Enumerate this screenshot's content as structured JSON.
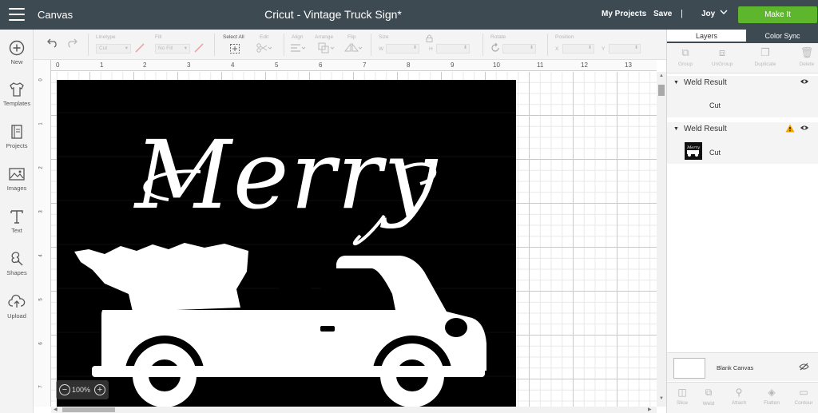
{
  "header": {
    "app_name": "Canvas",
    "doc_title": "Cricut - Vintage Truck Sign*",
    "my_projects": "My Projects",
    "save": "Save",
    "separator": "|",
    "user": "Joy",
    "make_it": "Make It",
    "make_it_color": "#5eb62c",
    "bar_color": "#3e4a52"
  },
  "left_tools": [
    {
      "label": "New",
      "icon": "plus-circle-icon"
    },
    {
      "label": "Templates",
      "icon": "tshirt-icon"
    },
    {
      "label": "Projects",
      "icon": "book-icon"
    },
    {
      "label": "Images",
      "icon": "image-icon"
    },
    {
      "label": "Text",
      "icon": "text-icon"
    },
    {
      "label": "Shapes",
      "icon": "shapes-icon"
    },
    {
      "label": "Upload",
      "icon": "cloud-upload-icon"
    }
  ],
  "toolbar": {
    "linetype_label": "Linetype",
    "linetype_value": "Cut",
    "fill_label": "Fill",
    "fill_value": "No Fill",
    "select_all": "Select All",
    "edit": "Edit",
    "align": "Align",
    "arrange": "Arrange",
    "flip": "Flip",
    "size": "Size",
    "size_w": "W",
    "size_h": "H",
    "rotate": "Rotate",
    "position": "Position",
    "pos_x": "X",
    "pos_y": "Y"
  },
  "ruler": {
    "top": [
      "0",
      "1",
      "2",
      "3",
      "4",
      "5",
      "6",
      "7",
      "8",
      "9",
      "10",
      "11",
      "12",
      "13"
    ],
    "left": [
      "0",
      "1",
      "2",
      "3",
      "4",
      "5",
      "6",
      "7"
    ]
  },
  "design": {
    "word": "Merry",
    "background": "#000000",
    "ink": "#ffffff"
  },
  "zoom": {
    "minus": "−",
    "value": "100%",
    "plus": "+"
  },
  "right_panel": {
    "tabs": [
      "Layers",
      "Color Sync"
    ],
    "actions": [
      "Group",
      "UnGroup",
      "Duplicate",
      "Delete"
    ],
    "layers": [
      {
        "name": "Weld Result",
        "item": "Cut",
        "warning": false
      },
      {
        "name": "Weld Result",
        "item": "Cut",
        "warning": true,
        "warning_color": "#f0a500"
      }
    ],
    "blank_canvas": "Blank Canvas",
    "bottom_actions": [
      "Slice",
      "Weld",
      "Attach",
      "Flatten",
      "Contour"
    ]
  }
}
